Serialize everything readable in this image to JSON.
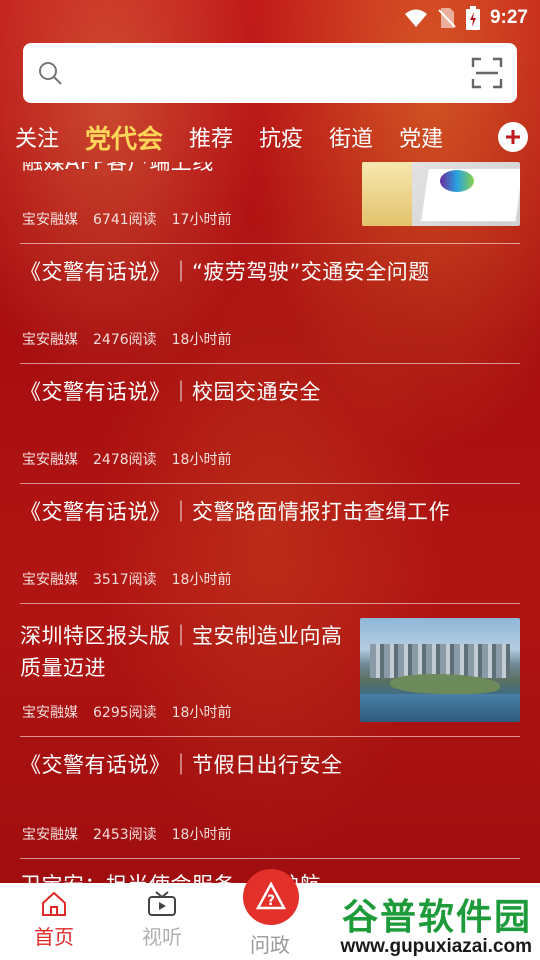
{
  "status_bar": {
    "time": "9:27"
  },
  "search": {
    "placeholder": ""
  },
  "tabs": [
    {
      "label": "关注"
    },
    {
      "label": "党代会"
    },
    {
      "label": "推荐"
    },
    {
      "label": "抗疫"
    },
    {
      "label": "街道"
    },
    {
      "label": "党建"
    }
  ],
  "active_tab": "党代会",
  "feed": [
    {
      "title": "融媒APP客户端上线",
      "source": "宝安融媒",
      "reads": "6741阅读",
      "time": "17小时前",
      "has_thumb": true
    },
    {
      "title": "《交警有话说》｜“疲劳驾驶”交通安全问题",
      "source": "宝安融媒",
      "reads": "2476阅读",
      "time": "18小时前"
    },
    {
      "title": "《交警有话说》｜校园交通安全",
      "source": "宝安融媒",
      "reads": "2478阅读",
      "time": "18小时前"
    },
    {
      "title": "《交警有话说》｜交警路面情报打击查缉工作",
      "source": "宝安融媒",
      "reads": "3517阅读",
      "time": "18小时前"
    },
    {
      "title": "深圳特区报头版｜宝安制造业向高质量迈进",
      "source": "宝安融媒",
      "reads": "6295阅读",
      "time": "18小时前",
      "has_thumb": true
    },
    {
      "title": "《交警有话说》｜节假日出行安全",
      "source": "宝安融媒",
      "reads": "2453阅读",
      "time": "18小时前"
    },
    {
      "title": "卫宝安：担当使命服务……护航",
      "source": "",
      "reads": "",
      "time": ""
    }
  ],
  "bottom_nav": [
    {
      "label": "首页",
      "icon": "home-icon"
    },
    {
      "label": "视听",
      "icon": "tv-icon"
    },
    {
      "label": "问政",
      "icon": "question-icon"
    }
  ],
  "watermark": {
    "cn": "谷普软件园",
    "url": "www.gupuxiazai.com"
  },
  "colors": {
    "accent": "#e02a2a",
    "active_tab": "#ffd65a",
    "bg": "#b51414"
  }
}
